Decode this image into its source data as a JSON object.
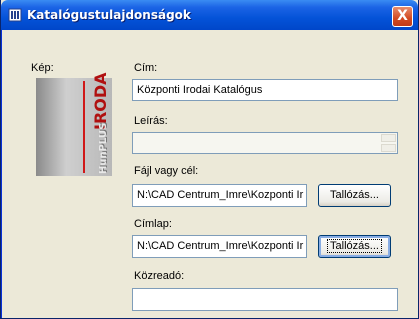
{
  "window": {
    "title": "Katalógustulajdonságok",
    "close_label": "X"
  },
  "image_label": "Kép:",
  "preview": {
    "main_text": "IRODA",
    "brand_text": "HunPLUS"
  },
  "fields": {
    "title": {
      "label": "Cím:",
      "value": "Központi Irodai Katalógus"
    },
    "description": {
      "label": "Leírás:",
      "value": ""
    },
    "file": {
      "label": "Fájl vagy cél:",
      "value": "N:\\CAD Centrum_Imre\\Kozponti Ir",
      "browse": "Tallózás..."
    },
    "cover": {
      "label": "Címlap:",
      "value": "N:\\CAD Centrum_Imre\\Kozponti Ir",
      "browse": "Tallózás..."
    },
    "publisher": {
      "label": "Közreadó:",
      "value": ""
    }
  },
  "colors": {
    "titlebar": "#0453d8",
    "face": "#ece9d8",
    "field_border": "#7f9db9",
    "logo_red": "#b01010"
  }
}
